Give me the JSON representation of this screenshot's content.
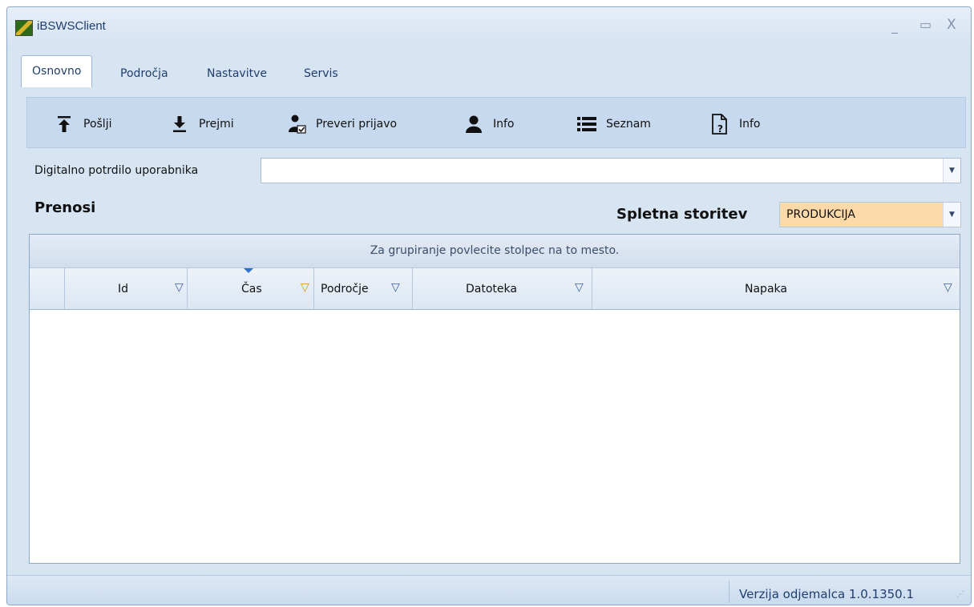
{
  "window": {
    "title": "iBSWSClient",
    "controls": {
      "minimize": "_",
      "maximize": "▭",
      "close": "X"
    }
  },
  "tabs": [
    {
      "label": "Osnovno",
      "active": true
    },
    {
      "label": "Področja",
      "active": false
    },
    {
      "label": "Nastavitve",
      "active": false
    },
    {
      "label": "Servis",
      "active": false
    }
  ],
  "toolbar": {
    "buttons": [
      {
        "label": "Pošlji",
        "icon": "upload-arrow-icon"
      },
      {
        "label": "Prejmi",
        "icon": "download-arrow-icon"
      },
      {
        "label": "Preveri prijavo",
        "icon": "user-check-icon"
      },
      {
        "label": "Info",
        "icon": "user-icon"
      },
      {
        "label": "Seznam",
        "icon": "list-icon"
      },
      {
        "label": "Info",
        "icon": "document-question-icon"
      }
    ]
  },
  "certificate": {
    "label": "Digitalno potrdilo uporabnika",
    "value": ""
  },
  "section": {
    "title": "Prenosi"
  },
  "service": {
    "label": "Spletna storitev",
    "value": "PRODUKCIJA",
    "highlight_color": "#fbd9a8"
  },
  "grid": {
    "group_hint": "Za grupiranje povlecite stolpec na to mesto.",
    "columns": [
      {
        "label": "Id",
        "filter_active": false
      },
      {
        "label": "Čas",
        "filter_active": true,
        "sorted": "desc"
      },
      {
        "label": "Področje",
        "filter_active": false
      },
      {
        "label": "Datoteka",
        "filter_active": false
      },
      {
        "label": "Napaka",
        "filter_active": false
      }
    ],
    "rows": []
  },
  "status": {
    "version": "Verzija odjemalca 1.0.1350.1"
  }
}
